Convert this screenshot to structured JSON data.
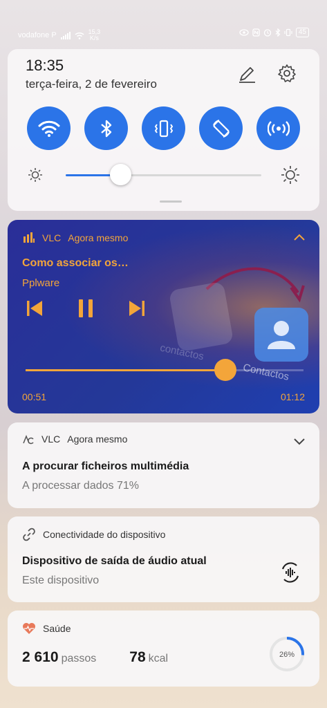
{
  "status_bar": {
    "carrier": "vodafone P",
    "speed_value": "15,3",
    "speed_unit": "K/s",
    "battery": "45"
  },
  "quick_settings": {
    "time": "18:35",
    "date": "terça-feira, 2 de fevereiro",
    "tiles": [
      "wifi-icon",
      "bluetooth-icon",
      "vibrate-icon",
      "auto-rotate-icon",
      "hotspot-icon"
    ],
    "brightness_level": 0.28,
    "accent_color": "#2b74e8"
  },
  "media": {
    "app": "VLC",
    "time": "Agora mesmo",
    "title": "Como associar os…",
    "artist": "Pplware",
    "current_time": "00:51",
    "total_time": "01:12",
    "progress": 0.72,
    "artwork_label_1": "contactos",
    "artwork_label_2": "Contactos",
    "accent_color": "#f3a53a"
  },
  "vlc_scan": {
    "app": "VLC",
    "time": "Agora mesmo",
    "title": "A procurar ficheiros multimédia",
    "subtitle": "A processar dados 71%"
  },
  "connectivity": {
    "header": "Conectividade do dispositivo",
    "title": "Dispositivo de saída de áudio atual",
    "subtitle": "Este dispositivo"
  },
  "health": {
    "header": "Saúde",
    "steps_value": "2 610",
    "steps_unit": "passos",
    "kcal_value": "78",
    "kcal_unit": "kcal",
    "goal_percent_label": "26%",
    "goal_fraction": 0.26,
    "heart_color": "#e8795a"
  }
}
